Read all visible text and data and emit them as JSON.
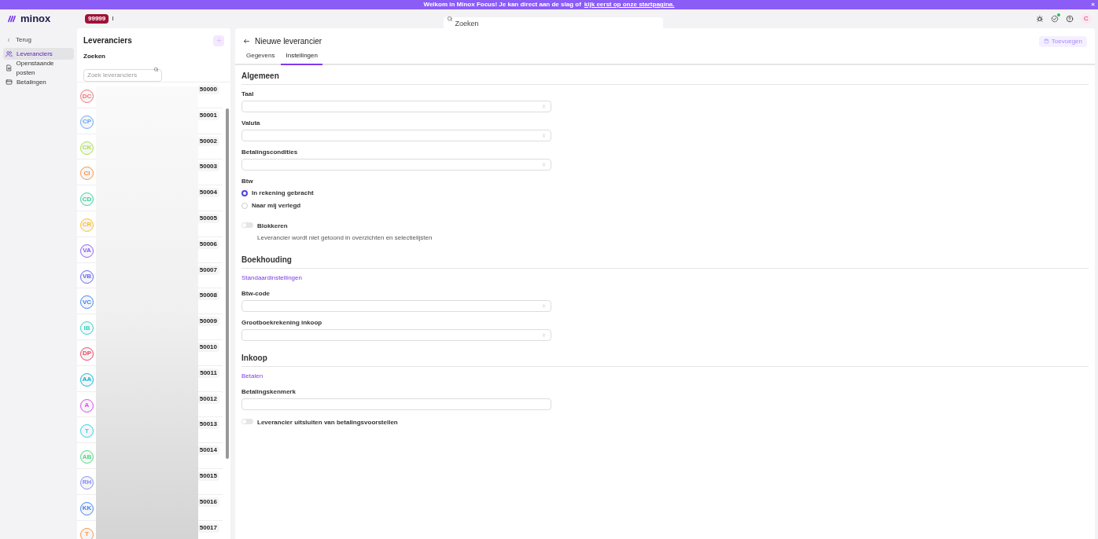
{
  "banner": {
    "text": "Welkom in Minox Focus! Je kan direct aan de slag of",
    "link": "kijk eerst op onze startpagina.",
    "close": "×"
  },
  "topbar": {
    "logo": "minox",
    "badge": "99999",
    "company_initial": "I",
    "search": {
      "placeholder": "Zoeken"
    },
    "avatar": "C"
  },
  "sidebar": {
    "back": "Terug",
    "items": [
      {
        "label": "Leveranciers",
        "selected": true
      },
      {
        "label": "Openstaande posten",
        "selected": false
      },
      {
        "label": "Betalingen",
        "selected": false
      }
    ]
  },
  "list": {
    "title": "Leveranciers",
    "search_label": "Zoeken",
    "search": {
      "placeholder": "Zoek leveranciers"
    },
    "rows": [
      {
        "initials": "DC",
        "code": "50000",
        "color": "#f87171"
      },
      {
        "initials": "CP",
        "code": "50001",
        "color": "#60a5fa"
      },
      {
        "initials": "CK",
        "code": "50002",
        "color": "#a3e635"
      },
      {
        "initials": "CI",
        "code": "50003",
        "color": "#fb923c"
      },
      {
        "initials": "CD",
        "code": "50004",
        "color": "#34d399"
      },
      {
        "initials": "CR",
        "code": "50005",
        "color": "#fbbf24"
      },
      {
        "initials": "VA",
        "code": "50006",
        "color": "#8b5cf6"
      },
      {
        "initials": "VB",
        "code": "50007",
        "color": "#6366f1"
      },
      {
        "initials": "VC",
        "code": "50008",
        "color": "#3b82f6"
      },
      {
        "initials": "IB",
        "code": "50009",
        "color": "#2dd4bf"
      },
      {
        "initials": "DP",
        "code": "50010",
        "color": "#f43f5e"
      },
      {
        "initials": "AA",
        "code": "50011",
        "color": "#06b6d4"
      },
      {
        "initials": "A",
        "code": "50012",
        "color": "#d946ef"
      },
      {
        "initials": "T",
        "code": "50013",
        "color": "#22d3ee"
      },
      {
        "initials": "AB",
        "code": "50014",
        "color": "#4ade80"
      },
      {
        "initials": "RH",
        "code": "50015",
        "color": "#818cf8"
      },
      {
        "initials": "KK",
        "code": "50016",
        "color": "#3b82f6"
      },
      {
        "initials": "T",
        "code": "50017",
        "color": "#fb923c"
      }
    ]
  },
  "main": {
    "title": "Nieuwe leverancier",
    "add_button": "Toevoegen",
    "tabs": [
      {
        "label": "Gegevens",
        "selected": false
      },
      {
        "label": "Instellingen",
        "selected": true
      }
    ],
    "sections": [
      {
        "title": "Algemeen",
        "items": [
          {
            "kind": "select",
            "label": "Taal"
          },
          {
            "kind": "select",
            "label": "Valuta"
          },
          {
            "kind": "select",
            "label": "Betalingscondities"
          },
          {
            "kind": "radio",
            "label": "Btw",
            "options": [
              {
                "label": "In rekening gebracht",
                "selected": true
              },
              {
                "label": "Naar mij verlegd",
                "selected": false
              }
            ]
          },
          {
            "kind": "toggle",
            "label": "Blokkeren",
            "hint": "Leverancier wordt niet getoond in overzichten en selectielijsten",
            "on": false
          }
        ]
      },
      {
        "title": "Boekhouding",
        "items": [
          {
            "kind": "subtitle",
            "label": "Standaardinstellingen"
          },
          {
            "kind": "select",
            "label": "Btw-code"
          },
          {
            "kind": "select",
            "label": "Grootboekrekening inkoop"
          }
        ]
      },
      {
        "title": "Inkoop",
        "items": [
          {
            "kind": "subtitle",
            "label": "Betalen"
          },
          {
            "kind": "text",
            "label": "Betalingskenmerk"
          },
          {
            "kind": "toggle",
            "label": "Leverancier uitsluiten van betalingsvoorstellen",
            "on": false
          }
        ]
      }
    ]
  }
}
